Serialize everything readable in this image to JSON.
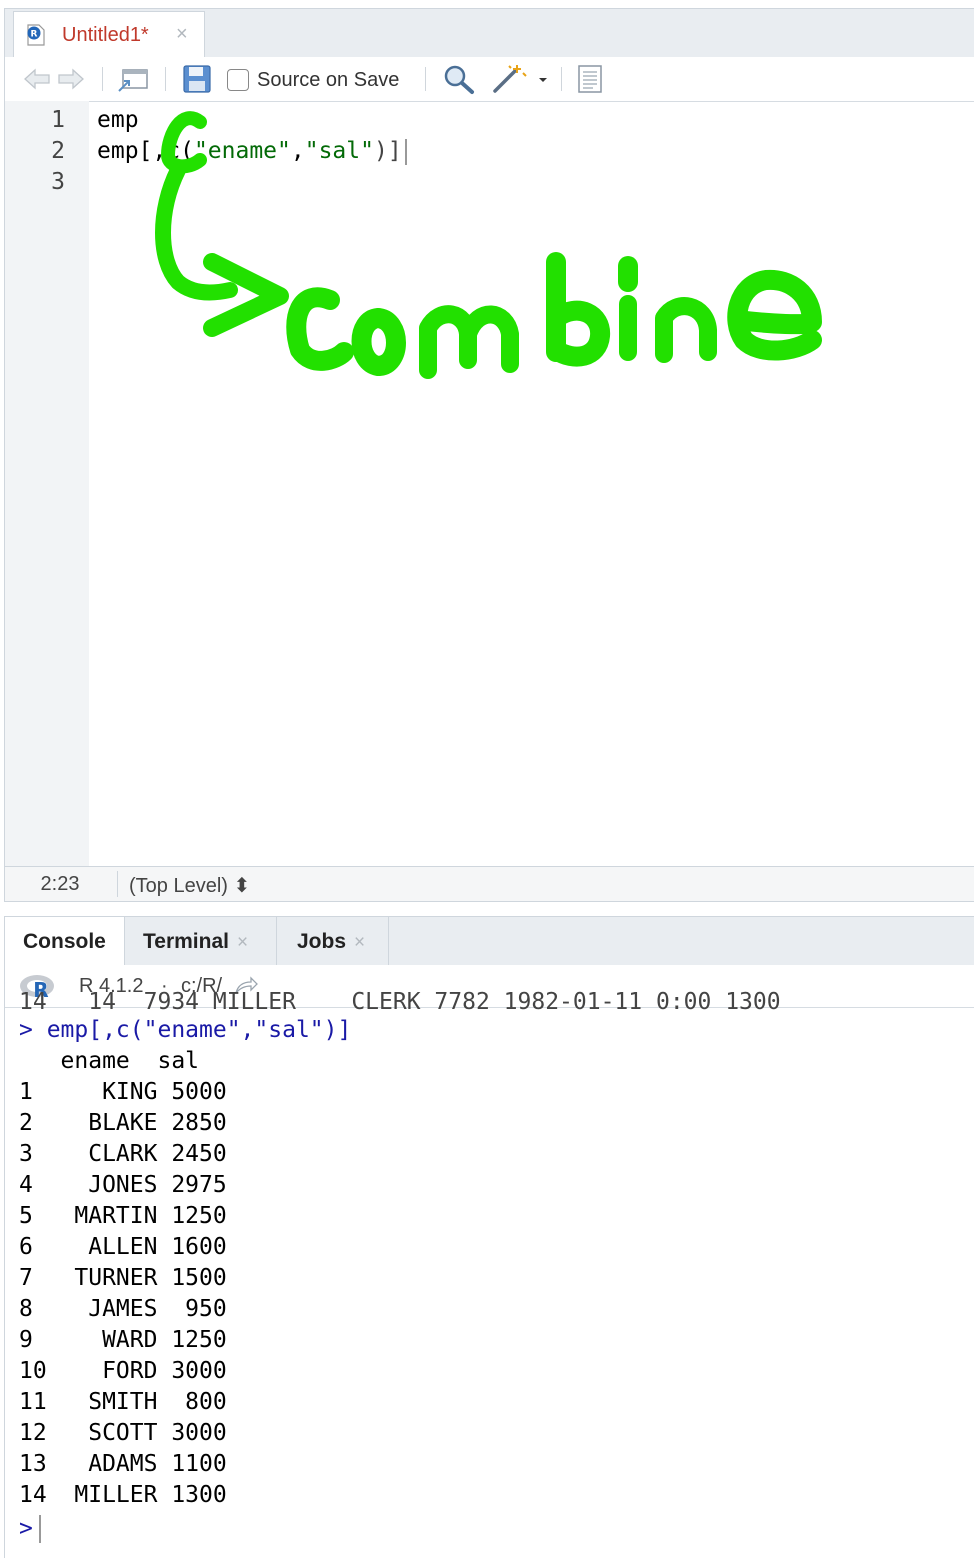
{
  "editor": {
    "tab": {
      "title": "Untitled1*",
      "close": "×"
    },
    "toolbar": {
      "source_on_save_label": "Source on Save"
    },
    "line_numbers": [
      "1",
      "2",
      "3"
    ],
    "lines": {
      "l1": "emp",
      "l2_prefix": "emp[,c(",
      "l2_str1": "\"ename\"",
      "l2_comma": ",",
      "l2_str2": "\"sal\"",
      "l2_suffix": ")]"
    },
    "status": {
      "position": "2:23",
      "scope": "(Top Level) ⬍"
    }
  },
  "annotation": {
    "text": "combine",
    "color": "#22e000"
  },
  "console": {
    "tabs": [
      {
        "label": "Console",
        "close": ""
      },
      {
        "label": "Terminal",
        "close": "×"
      },
      {
        "label": "Jobs",
        "close": "×"
      }
    ],
    "r_version": "R 4.1.2",
    "separator": "·",
    "working_dir": "c:/R/",
    "truncated_line": "14   14  7934 MILLER    CLERK 7782 1982-01-11 0:00 1300",
    "command": "> emp[,c(\"ename\",\"sal\")]",
    "header": "   ename  sal",
    "rows": [
      "1     KING 5000",
      "2    BLAKE 2850",
      "3    CLARK 2450",
      "4    JONES 2975",
      "5   MARTIN 1250",
      "6    ALLEN 1600",
      "7   TURNER 1500",
      "8    JAMES  950",
      "9     WARD 1250",
      "10    FORD 3000",
      "11   SMITH  800",
      "12   SCOTT 3000",
      "13   ADAMS 1100",
      "14  MILLER 1300"
    ],
    "prompt": ">"
  }
}
